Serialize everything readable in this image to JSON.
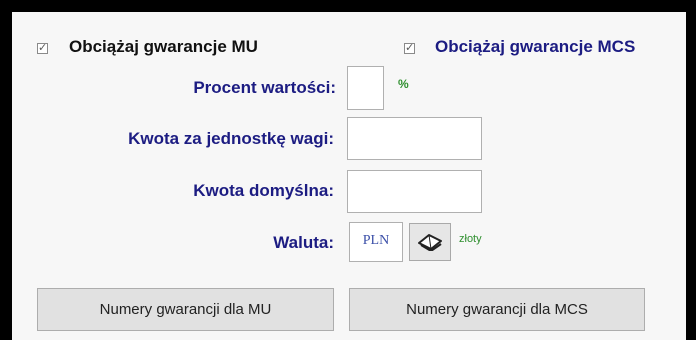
{
  "checkboxes": {
    "mu": {
      "label": "Obciążaj gwarancje MU",
      "checked": true,
      "color": "#111111"
    },
    "mcs": {
      "label": "Obciążaj gwarancje MCS",
      "checked": true,
      "color": "#1c1c82"
    }
  },
  "fields": {
    "percent": {
      "label": "Procent wartości:",
      "value": "",
      "suffix": "%"
    },
    "amount_per_weight": {
      "label": "Kwota za jednostkę wagi:",
      "value": ""
    },
    "default_amount": {
      "label": "Kwota domyślna:",
      "value": ""
    },
    "currency": {
      "label": "Waluta:",
      "value": "PLN",
      "name": "złoty"
    }
  },
  "buttons": {
    "mu_numbers": "Numery gwarancji dla MU",
    "mcs_numbers": "Numery gwarancji dla MCS"
  },
  "icons": {
    "currency_lookup": "book-lookup-icon",
    "checkbox_tick": "check-icon"
  },
  "colors": {
    "label_blue": "#1c1c82",
    "suffix_green": "#2f8f2f",
    "panel_bg": "#f7f7f7"
  }
}
